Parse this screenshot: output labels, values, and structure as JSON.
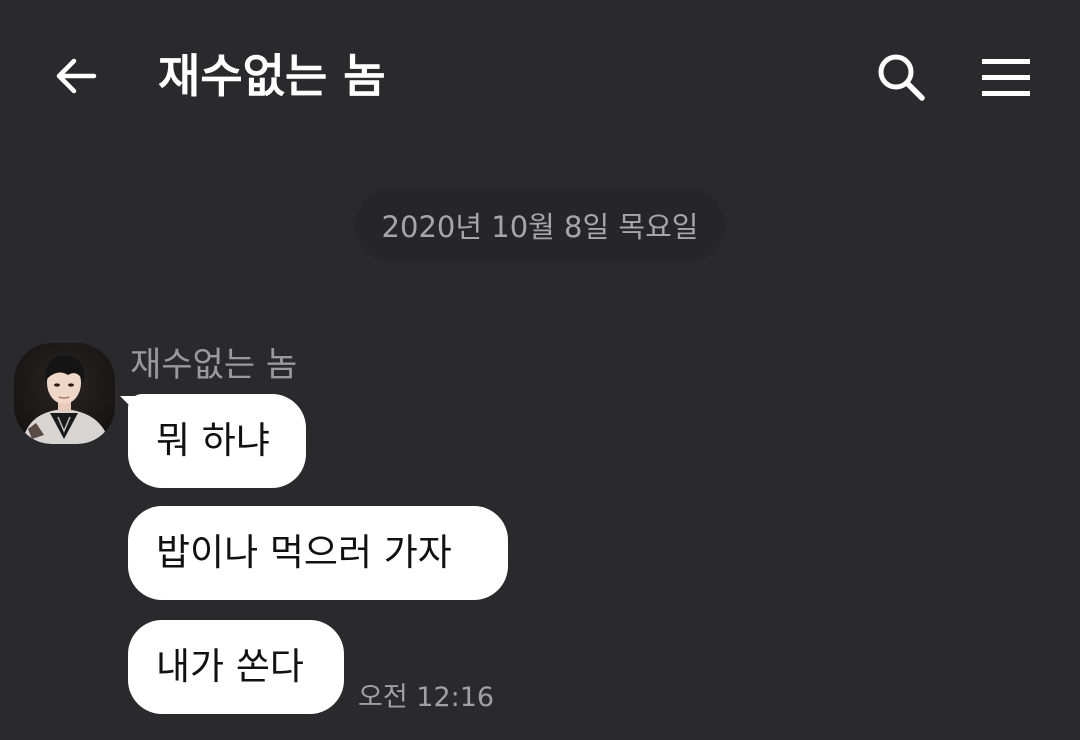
{
  "header": {
    "title": "재수없는 놈",
    "back_icon": "arrow-left-icon",
    "search_icon": "search-icon",
    "menu_icon": "hamburger-menu-icon"
  },
  "date_divider": "2020년 10월 8일 목요일",
  "thread": {
    "sender_name": "재수없는 놈",
    "avatar_icon": "profile-photo",
    "messages": [
      {
        "text": "뭐 하냐"
      },
      {
        "text": "밥이나 먹으러 가자"
      },
      {
        "text": "내가 쏜다"
      }
    ],
    "timestamp": "오전 12:16"
  },
  "colors": {
    "background": "#2a2a2c",
    "bubble": "#ffffff",
    "date_pill": "#262628",
    "muted_text": "#9a9a9c"
  }
}
